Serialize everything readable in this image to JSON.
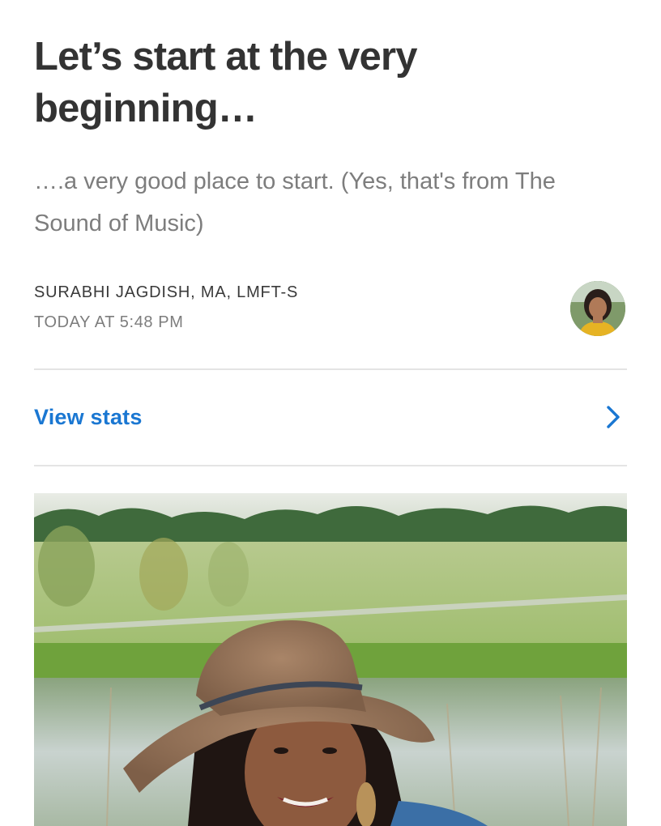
{
  "post": {
    "title": "Let’s start at the very beginning…",
    "subtitle": "….a very good place to start. (Yes, that's from The Sound of Music)",
    "author": "SURABHI JAGDISH, MA, LMFT-S",
    "timestamp": "TODAY AT 5:48 PM"
  },
  "stats": {
    "label": "View stats",
    "icon": "chevron-right-icon"
  },
  "colors": {
    "link": "#1a77d2",
    "title": "#333333",
    "muted": "#7d7d7d",
    "divider": "#e4e4e4"
  }
}
